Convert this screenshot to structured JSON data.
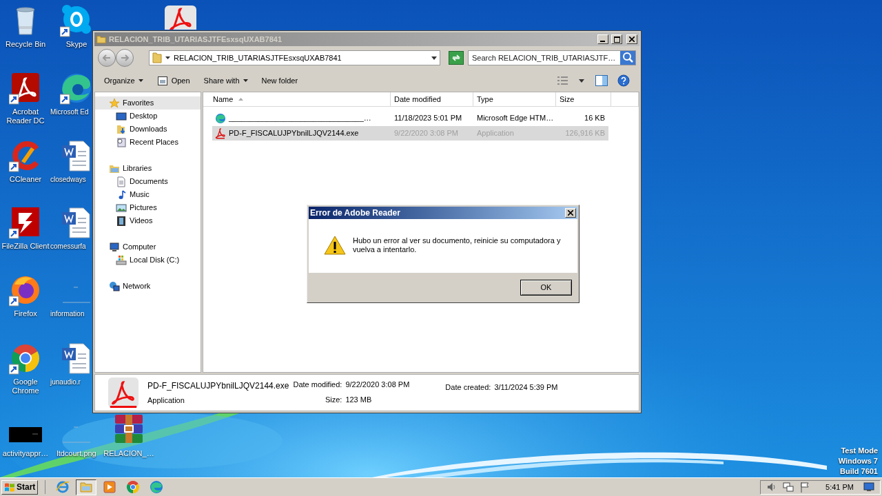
{
  "desktop": {
    "icons": [
      {
        "kind": "recycle",
        "label": "Recycle Bin",
        "shortcut": false
      },
      {
        "kind": "acrobat",
        "label": "Acrobat Reader DC",
        "shortcut": true
      },
      {
        "kind": "ccleaner",
        "label": "CCleaner",
        "shortcut": true
      },
      {
        "kind": "filezilla",
        "label": "FileZilla Client",
        "shortcut": true
      },
      {
        "kind": "firefox",
        "label": "Firefox",
        "shortcut": true
      },
      {
        "kind": "chrome",
        "label": "Google Chrome",
        "shortcut": true
      },
      {
        "kind": "dark_thumb",
        "label": "activityappr…",
        "shortcut": false
      },
      {
        "kind": "skype",
        "label": "Skype",
        "shortcut": true
      },
      {
        "kind": "edge",
        "label": "Microsoft Ed",
        "shortcut": true
      },
      {
        "kind": "word",
        "label": "closedways",
        "shortcut": false
      },
      {
        "kind": "word",
        "label": "comessurfa",
        "shortcut": false
      },
      {
        "kind": "blank_thumb",
        "label": "information",
        "shortcut": false
      },
      {
        "kind": "word",
        "label": "junaudio.r",
        "shortcut": false
      },
      {
        "kind": "blank_thumb",
        "label": "ltdcourt.png",
        "shortcut": false
      },
      {
        "kind": "pdf_file",
        "shortcut": false
      },
      {
        "kind": "archive",
        "label": "RELACION_…",
        "shortcut": false
      }
    ],
    "system_notice": [
      "Test Mode",
      "Windows 7",
      "Build 7601"
    ]
  },
  "explorer": {
    "title": "RELACION_TRIB_UTARIASJTFEsxsqUXAB7841",
    "address": "RELACION_TRIB_UTARIASJTFEsxsqUXAB7841",
    "search": {
      "placeholder": "Search RELACION_TRIB_UTARIASJTF…"
    },
    "toolbar": [
      {
        "kind": "menu",
        "label": "Organize"
      },
      {
        "kind": "open",
        "label": "Open"
      },
      {
        "kind": "menu",
        "label": "Share with"
      },
      {
        "kind": "plain",
        "label": "New folder"
      }
    ],
    "navigation": [
      {
        "label": "Favorites",
        "selected": true,
        "children": [
          {
            "label": "Desktop",
            "selected": false
          },
          {
            "label": "Downloads",
            "selected": false
          },
          {
            "label": "Recent Places",
            "selected": false
          }
        ]
      },
      {
        "label": "Libraries",
        "selected": false,
        "children": [
          {
            "label": "Documents",
            "selected": false
          },
          {
            "label": "Music",
            "selected": false
          },
          {
            "label": "Pictures",
            "selected": false
          },
          {
            "label": "Videos",
            "selected": false
          }
        ]
      },
      {
        "label": "Computer",
        "selected": false,
        "children": [
          {
            "label": "Local Disk (C:)",
            "selected": false
          }
        ]
      },
      {
        "label": "Network",
        "selected": false
      }
    ],
    "columns": [
      {
        "label": "Name",
        "sorted": true
      },
      {
        "label": "Date modified",
        "sorted": false
      },
      {
        "label": "Type",
        "sorted": false
      },
      {
        "label": "Size",
        "sorted": false
      }
    ],
    "files": [
      {
        "kind": "web_page",
        "name": "________________________________…",
        "date_modified": "11/18/2023 5:01 PM",
        "type": "Microsoft Edge HTM…",
        "size": "16 KB",
        "selected": false
      },
      {
        "kind": "application",
        "name": "PD-F_FISCALUJPYbnilLJQV2144.exe",
        "date_modified": "9/22/2020 3:08 PM",
        "type": "Application",
        "size": "126,916 KB",
        "selected": true
      }
    ],
    "details": {
      "name": "PD-F_FISCALUJPYbnilLJQV2144.exe",
      "type": "Application",
      "fields": [
        {
          "label": "Date modified:",
          "value": "9/22/2020 3:08 PM"
        },
        {
          "label": "Size:",
          "value": "123 MB"
        },
        {
          "label": "Date created:",
          "value": "3/11/2024 5:39 PM"
        }
      ]
    }
  },
  "dialog": {
    "title": "Error de Adobe Reader",
    "message": "Hubo un error al ver su documento, reinicie su computadora y vuelva a intentarlo.",
    "buttons": [
      "OK"
    ]
  },
  "taskbar": {
    "start": "Start",
    "pinned": [
      {
        "kind": "ie",
        "active": false
      },
      {
        "kind": "explorer",
        "active": true
      },
      {
        "kind": "media",
        "active": false
      },
      {
        "kind": "chrome",
        "active": false
      },
      {
        "kind": "edge",
        "active": false
      }
    ],
    "tray": {
      "icons": [
        {
          "kind": "speaker"
        },
        {
          "kind": "network"
        },
        {
          "kind": "flag"
        }
      ],
      "time": "5:41 PM"
    }
  }
}
